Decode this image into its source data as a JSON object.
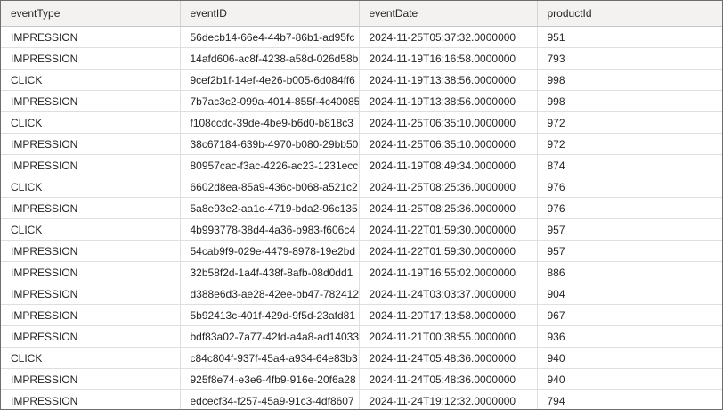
{
  "table": {
    "columns": [
      "eventType",
      "eventID",
      "eventDate",
      "productId"
    ],
    "rows": [
      [
        "IMPRESSION",
        "56decb14-66e4-44b7-86b1-ad95fc",
        "2024-11-25T05:37:32.0000000",
        "951"
      ],
      [
        "IMPRESSION",
        "14afd606-ac8f-4238-a58d-026d58b",
        "2024-11-19T16:16:58.0000000",
        "793"
      ],
      [
        "CLICK",
        "9cef2b1f-14ef-4e26-b005-6d084ff6",
        "2024-11-19T13:38:56.0000000",
        "998"
      ],
      [
        "IMPRESSION",
        "7b7ac3c2-099a-4014-855f-4c40085",
        "2024-11-19T13:38:56.0000000",
        "998"
      ],
      [
        "CLICK",
        "f108ccdc-39de-4be9-b6d0-b818c3",
        "2024-11-25T06:35:10.0000000",
        "972"
      ],
      [
        "IMPRESSION",
        "38c67184-639b-4970-b080-29bb50",
        "2024-11-25T06:35:10.0000000",
        "972"
      ],
      [
        "IMPRESSION",
        "80957cac-f3ac-4226-ac23-1231ecc",
        "2024-11-19T08:49:34.0000000",
        "874"
      ],
      [
        "CLICK",
        "6602d8ea-85a9-436c-b068-a521c2",
        "2024-11-25T08:25:36.0000000",
        "976"
      ],
      [
        "IMPRESSION",
        "5a8e93e2-aa1c-4719-bda2-96c135",
        "2024-11-25T08:25:36.0000000",
        "976"
      ],
      [
        "CLICK",
        "4b993778-38d4-4a36-b983-f606c4",
        "2024-11-22T01:59:30.0000000",
        "957"
      ],
      [
        "IMPRESSION",
        "54cab9f9-029e-4479-8978-19e2bd",
        "2024-11-22T01:59:30.0000000",
        "957"
      ],
      [
        "IMPRESSION",
        "32b58f2d-1a4f-438f-8afb-08d0dd1",
        "2024-11-19T16:55:02.0000000",
        "886"
      ],
      [
        "IMPRESSION",
        "d388e6d3-ae28-42ee-bb47-782412",
        "2024-11-24T03:03:37.0000000",
        "904"
      ],
      [
        "IMPRESSION",
        "5b92413c-401f-429d-9f5d-23afd81",
        "2024-11-20T17:13:58.0000000",
        "967"
      ],
      [
        "IMPRESSION",
        "bdf83a02-7a77-42fd-a4a8-ad14033",
        "2024-11-21T00:38:55.0000000",
        "936"
      ],
      [
        "CLICK",
        "c84c804f-937f-45a4-a934-64e83b3",
        "2024-11-24T05:48:36.0000000",
        "940"
      ],
      [
        "IMPRESSION",
        "925f8e74-e3e6-4fb9-916e-20f6a28",
        "2024-11-24T05:48:36.0000000",
        "940"
      ],
      [
        "IMPRESSION",
        "edcecf34-f257-45a9-91c3-4df8607",
        "2024-11-24T19:12:32.0000000",
        "794"
      ]
    ]
  },
  "colors": {
    "header_bg": "#f3f2f1",
    "grid_line": "#e1dfdd",
    "text": "#252423",
    "frame_border": "#6e6e6e"
  }
}
